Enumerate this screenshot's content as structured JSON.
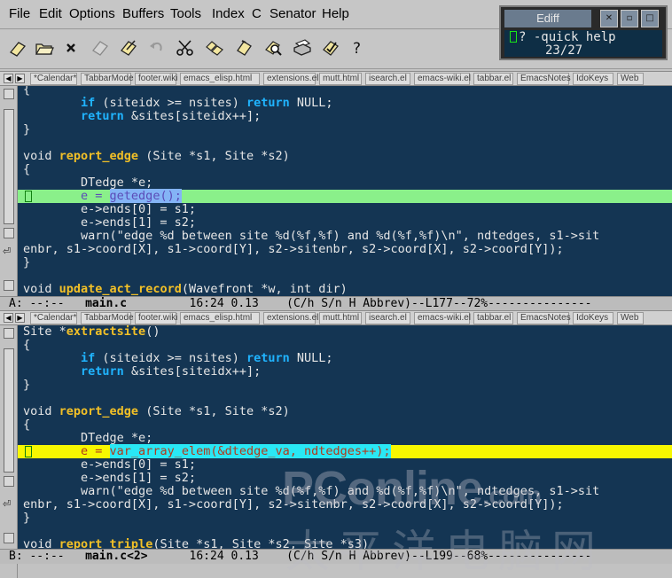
{
  "menubar": {
    "items": [
      "File",
      "Edit",
      "Options",
      "Buffers",
      "Tools",
      "Index",
      "C",
      "Senator",
      "Help"
    ]
  },
  "toolbar": {
    "icons": [
      "new-file-icon",
      "open-folder-icon",
      "close-buffer-icon",
      "save-icon",
      "save-as-icon",
      "undo-icon",
      "cut-icon",
      "copy-icon",
      "paste-icon",
      "search-icon",
      "print-icon",
      "preferences-icon",
      "help-icon"
    ]
  },
  "ediff": {
    "title": "Ediff",
    "help_line": "? -quick help",
    "position": "23/27"
  },
  "tabs": [
    "*Calendar*",
    "TabbarMode",
    "footer.wiki",
    "emacs_elisp.html",
    "extensions.el",
    "mutt.html",
    "isearch.el",
    "emacs-wiki.el",
    "tabbar.el",
    "EmacsNotes",
    "IdoKeys",
    "Web"
  ],
  "pane_a": {
    "lines": [
      "{",
      "        if (siteidx >= nsites) return NULL;",
      "        return &sites[siteidx++];",
      "}",
      "",
      "void report_edge (Site *s1, Site *s2)",
      "{",
      "        DTedge *e;",
      "        e = getedge();",
      "        e->ends[0] = s1;",
      "        e->ends[1] = s2;",
      "        warn(\"edge %d between site %d(%f,%f) and %d(%f,%f)\\n\", ndtedges, s1->sit",
      "enbr, s1->coord[X], s1->coord[Y], s2->sitenbr, s2->coord[X], s2->coord[Y]);",
      "}",
      "",
      "void update_act_record(Wavefront *w, int dir)"
    ],
    "highlight_color": "#8af08a",
    "highlight_text_color": "#5b4bb7",
    "diff_color": "#84b4f6",
    "diff_text": "getedge();"
  },
  "modeline_a": {
    "label": "A: --:--",
    "buffer": "main.c",
    "info": "16:24 0.13",
    "mode": "(C/h S/n H Abbrev)--L177--72%"
  },
  "pane_b": {
    "lines": [
      "Site *extractsite()",
      "{",
      "        if (siteidx >= nsites) return NULL;",
      "        return &sites[siteidx++];",
      "}",
      "",
      "void report_edge (Site *s1, Site *s2)",
      "{",
      "        DTedge *e;",
      "        e = var_array_elem(&dtedge_va, ndtedges++);",
      "        e->ends[0] = s1;",
      "        e->ends[1] = s2;",
      "        warn(\"edge %d between site %d(%f,%f) and %d(%f,%f)\\n\", ndtedges, s1->sit",
      "enbr, s1->coord[X], s1->coord[Y], s2->sitenbr, s2->coord[X], s2->coord[Y]);",
      "}",
      "",
      "void report_triple(Site *s1, Site *s2, Site *s3)"
    ],
    "highlight_color": "#f7f700",
    "highlight_text_color": "#b23a1c",
    "diff_color": "#29e8f5",
    "diff_text": "var_array_elem(&dtedge_va, ndtedges++);"
  },
  "modeline_b": {
    "label": "B: --:--",
    "buffer": "main.c<2>",
    "info": "16:24 0.13",
    "mode": "(C/h S/n H Abbrev)--L199--68%"
  },
  "watermark": {
    "main": "PConline",
    "suffix": ".com",
    "cn": "太平洋电脑网"
  }
}
